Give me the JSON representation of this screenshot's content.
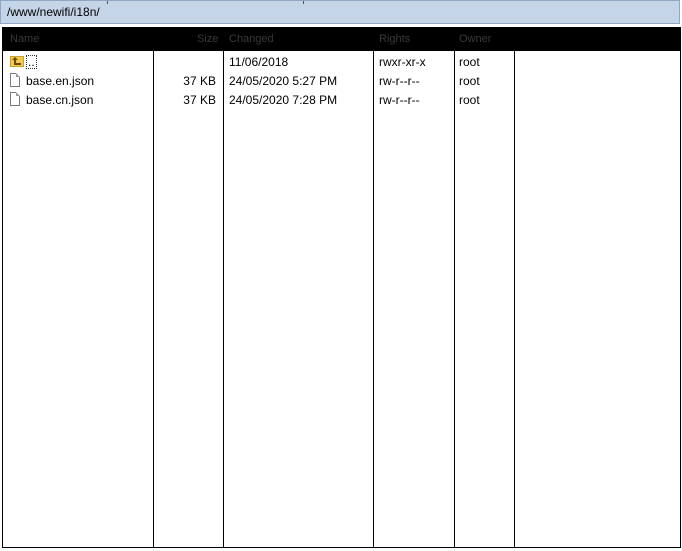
{
  "path_bar": {
    "path": "/www/newifi/i18n/"
  },
  "columns": [
    "Name",
    "Size",
    "Changed",
    "Rights",
    "Owner"
  ],
  "rows": [
    {
      "icon": "parent-folder-icon",
      "name": "..",
      "size": "",
      "changed": "11/06/2018",
      "rights": "rwxr-xr-x",
      "owner": "root"
    },
    {
      "icon": "file-icon",
      "name": "base.en.json",
      "size": "37 KB",
      "changed": "24/05/2020 5:27 PM",
      "rights": "rw-r--r--",
      "owner": "root"
    },
    {
      "icon": "file-icon",
      "name": "base.cn.json",
      "size": "37 KB",
      "changed": "24/05/2020 7:28 PM",
      "rights": "rw-r--r--",
      "owner": "root"
    }
  ],
  "colors": {
    "path_bar_bg": "#c5d5e8",
    "header_bg": "#000000",
    "folder_icon": "#f2c94c"
  }
}
